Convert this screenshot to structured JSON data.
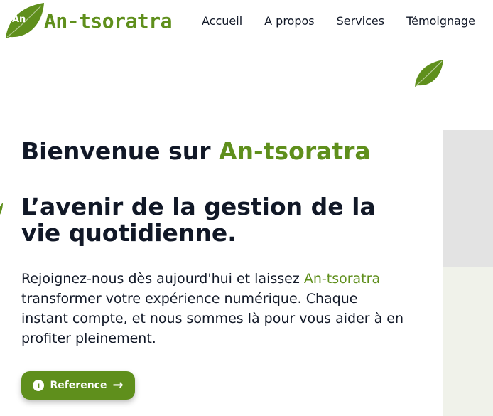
{
  "brand": {
    "mark": "An",
    "name": "An-tsoratra",
    "color": "#5f8f1c"
  },
  "nav": {
    "items": [
      "Accueil",
      "A propos",
      "Services",
      "Témoignage"
    ]
  },
  "hero": {
    "welcome_prefix": "Bienvenue sur ",
    "welcome_brand": "An-tsoratra",
    "headline": "L’avenir de la gestion de la vie quotidienne.",
    "para_prefix": "Rejoignez-nous dès aujourd'hui et laissez ",
    "para_brand": "An-tsoratra",
    "para_suffix": " transformer votre expérience numérique. Chaque instant compte, et nous sommes là pour vous aider à en profiter pleinement."
  },
  "cta": {
    "label": "Reference",
    "icon": "info-icon",
    "arrow": "arrow-right-icon"
  },
  "colors": {
    "accent": "#5f8f1c",
    "text": "#111827",
    "panel_top": "#e3e3e3",
    "panel_bottom": "#f0f2ea"
  }
}
